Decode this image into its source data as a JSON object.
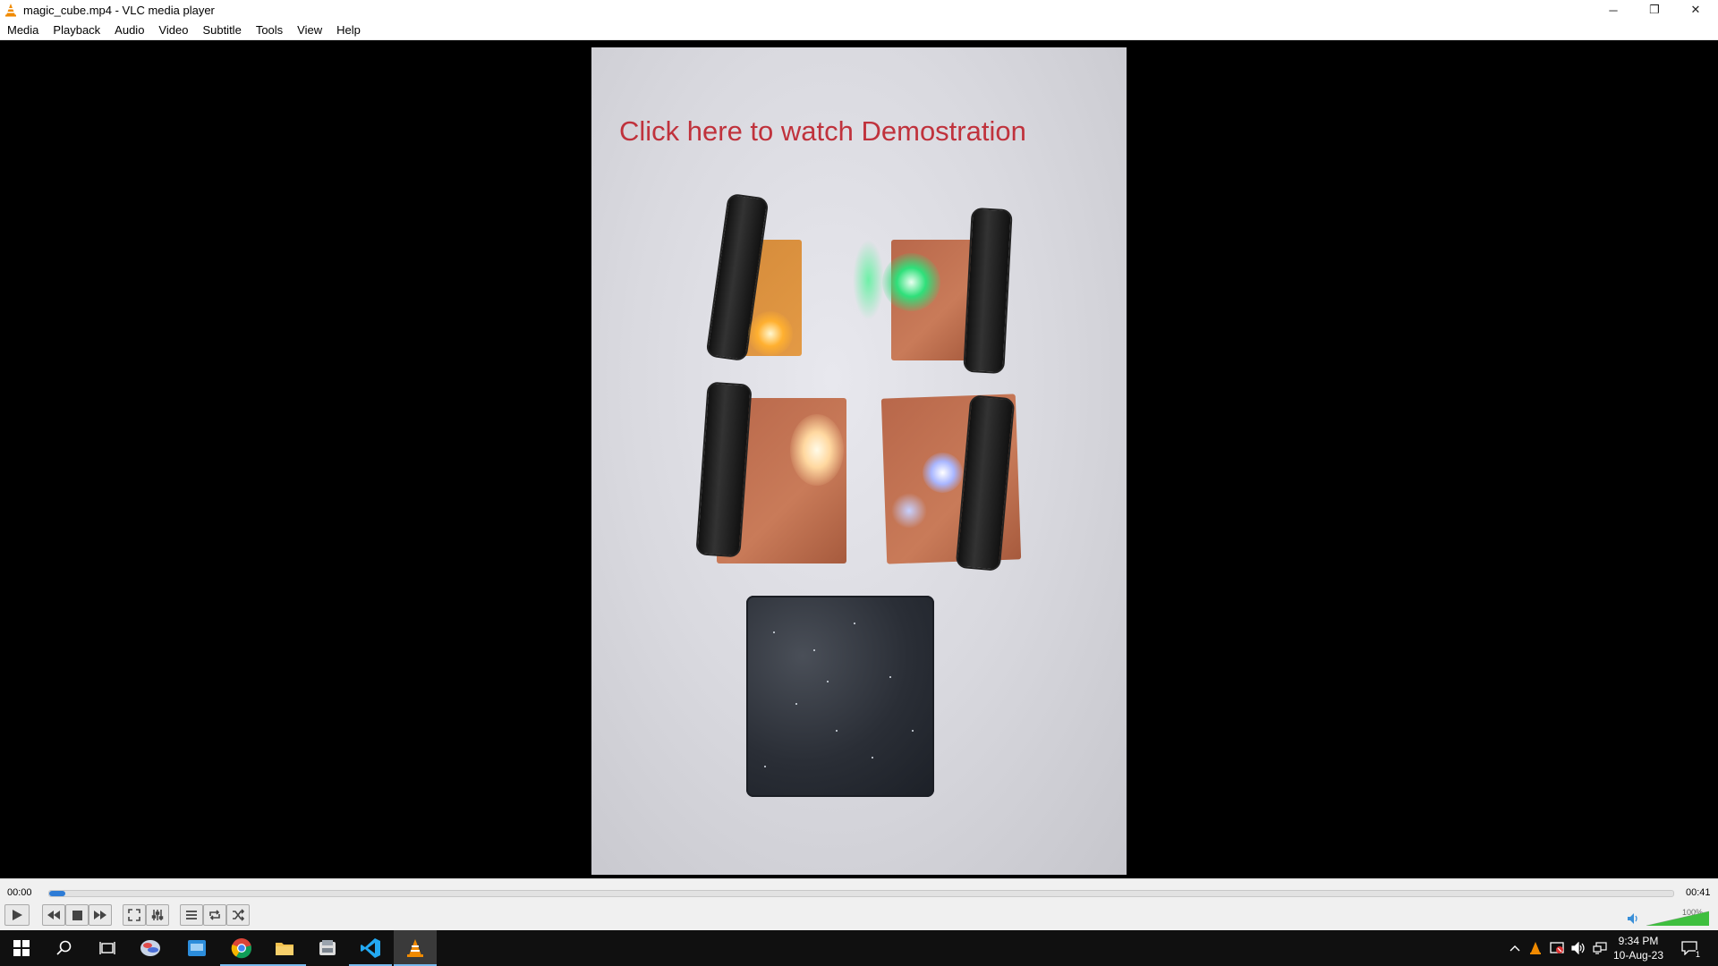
{
  "window": {
    "title": "magic_cube.mp4 - VLC media player",
    "minimize_glyph": "─",
    "restore_glyph": "❐",
    "close_glyph": "✕"
  },
  "menu": [
    "Media",
    "Playback",
    "Audio",
    "Video",
    "Subtitle",
    "Tools",
    "View",
    "Help"
  ],
  "video": {
    "overlay_text": "Click here to watch  Demostration"
  },
  "player": {
    "elapsed": "00:00",
    "total": "00:41",
    "progress": 0.01,
    "volume_label": "100%",
    "volume": 1.0,
    "buttons": [
      "play-icon",
      "previous-icon",
      "stop-icon",
      "next-icon",
      "fullscreen-icon",
      "extended-settings-icon",
      "playlist-icon",
      "loop-icon",
      "shuffle-icon"
    ]
  },
  "taskbar": {
    "apps": [
      "windows-start-icon",
      "search-icon",
      "task-view-icon",
      "app-icon",
      "finder-icon",
      "chrome-icon",
      "file-explorer-icon",
      "app-icon-2",
      "vscode-icon",
      "vlc-icon"
    ],
    "time": "9:34 PM",
    "date": "10-Aug-23",
    "notification_count": "1"
  },
  "colors": {
    "accent_seek": "#2e7cd6",
    "overlay_text": "#c0323c",
    "volume_green": "#3fbf3f",
    "taskbar_bg": "#101010"
  }
}
